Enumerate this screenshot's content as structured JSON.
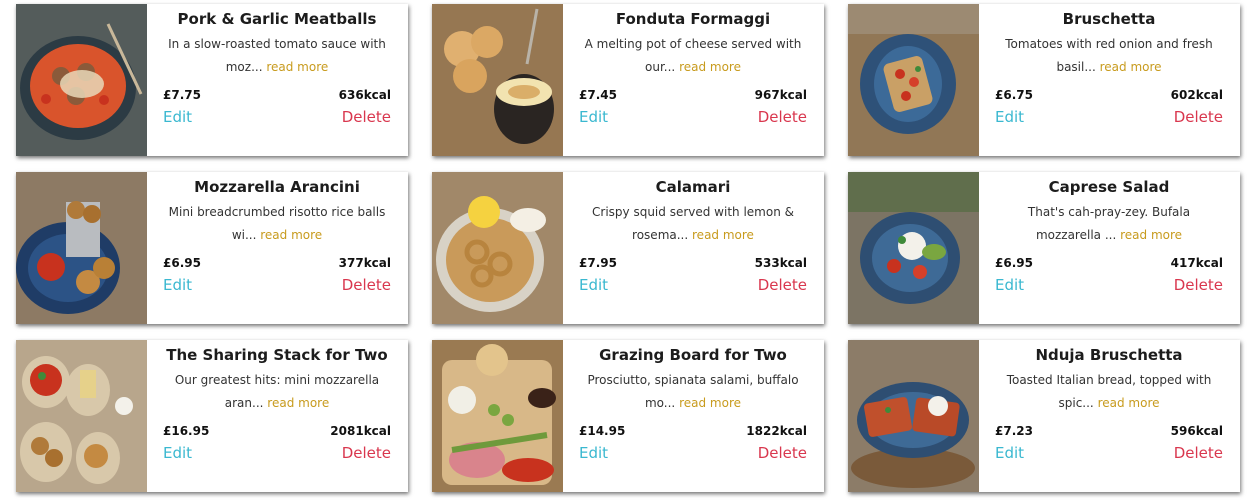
{
  "colors": {
    "edit": "#3ab8d0",
    "delete": "#d9374e",
    "read_more": "#c89b1e"
  },
  "cards": [
    {
      "title": "Pork & Garlic Meatballs",
      "desc": "In a slow-roasted tomato sauce with moz...",
      "read_more": "read more",
      "price": "£7.75",
      "kcal": "636kcal",
      "edit": "Edit",
      "delete": "Delete"
    },
    {
      "title": "Fonduta Formaggi",
      "desc": "A melting pot of cheese served with our...",
      "read_more": "read more",
      "price": "£7.45",
      "kcal": "967kcal",
      "edit": "Edit",
      "delete": "Delete"
    },
    {
      "title": "Bruschetta",
      "desc": "Tomatoes with red onion and fresh basil...",
      "read_more": "read more",
      "price": "£6.75",
      "kcal": "602kcal",
      "edit": "Edit",
      "delete": "Delete"
    },
    {
      "title": "Mozzarella Arancini",
      "desc": "Mini breadcrumbed risotto rice balls wi...",
      "read_more": "read more",
      "price": "£6.95",
      "kcal": "377kcal",
      "edit": "Edit",
      "delete": "Delete"
    },
    {
      "title": "Calamari",
      "desc": "Crispy squid served with lemon & rosema...",
      "read_more": "read more",
      "price": "£7.95",
      "kcal": "533kcal",
      "edit": "Edit",
      "delete": "Delete"
    },
    {
      "title": "Caprese Salad",
      "desc": "That's cah-pray-zey. Bufala mozzarella ...",
      "read_more": "read more",
      "price": "£6.95",
      "kcal": "417kcal",
      "edit": "Edit",
      "delete": "Delete"
    },
    {
      "title": "The Sharing Stack for Two",
      "desc": "Our greatest hits: mini mozzarella aran...",
      "read_more": "read more",
      "price": "£16.95",
      "kcal": "2081kcal",
      "edit": "Edit",
      "delete": "Delete"
    },
    {
      "title": "Grazing Board for Two",
      "desc": "Prosciutto, spianata salami, buffalo mo...",
      "read_more": "read more",
      "price": "£14.95",
      "kcal": "1822kcal",
      "edit": "Edit",
      "delete": "Delete"
    },
    {
      "title": "Nduja Bruschetta",
      "desc": "Toasted Italian bread, topped with spic...",
      "read_more": "read more",
      "price": "£7.23",
      "kcal": "596kcal",
      "edit": "Edit",
      "delete": "Delete"
    }
  ]
}
